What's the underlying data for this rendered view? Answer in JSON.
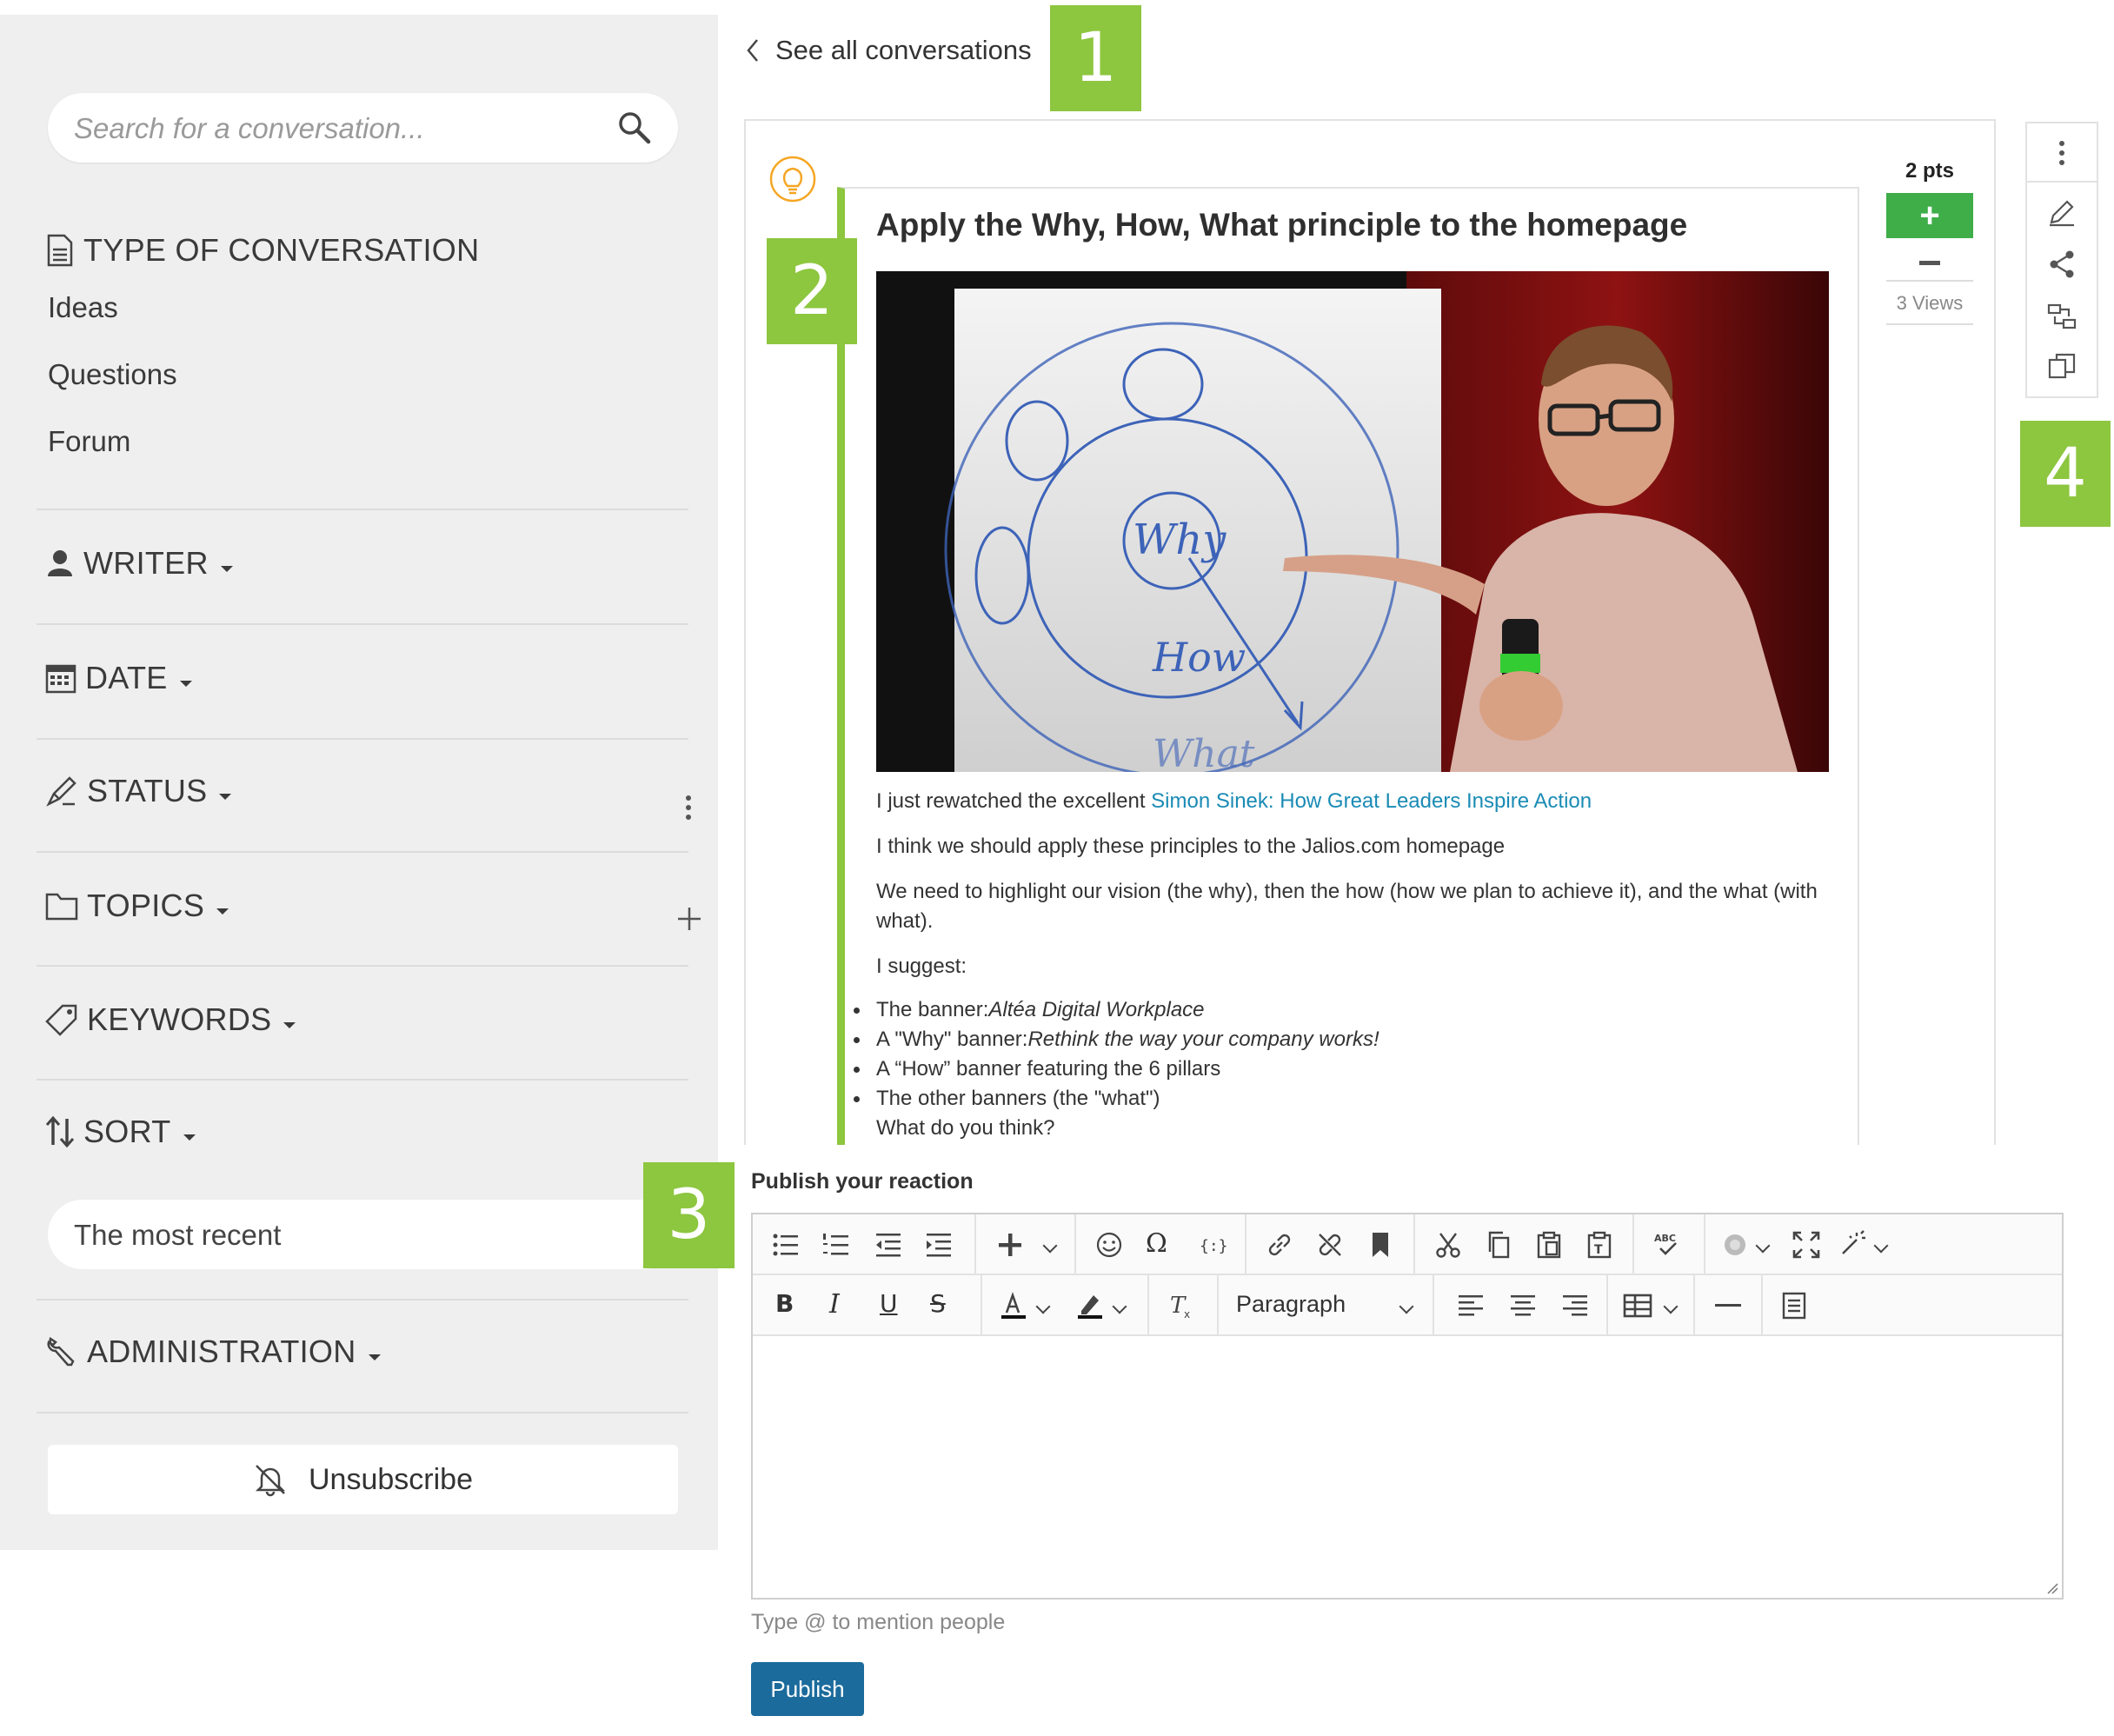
{
  "sidebar": {
    "search_placeholder": "Search for a conversation...",
    "type_section": {
      "title": "TYPE OF CONVERSATION",
      "items": [
        "Ideas",
        "Questions",
        "Forum"
      ]
    },
    "filters": {
      "writer": "WRITER",
      "date": "DATE",
      "status": "STATUS",
      "topics": "TOPICS",
      "keywords": "KEYWORDS",
      "sort": "SORT",
      "administration": "ADMINISTRATION"
    },
    "sort_value": "The most recent",
    "unsubscribe_label": "Unsubscribe"
  },
  "callouts": [
    "1",
    "2",
    "3",
    "4"
  ],
  "header": {
    "back_link": "See all conversations"
  },
  "post": {
    "title": "Apply the Why, How, What principle to the homepage",
    "intro_prefix": "I just rewatched the excellent ",
    "intro_link": "Simon Sinek: How Great Leaders Inspire Action",
    "para2": "I think we should apply these principles to the Jalios.com homepage",
    "para3": "We need to highlight our vision (the why), then the how (how we plan to achieve it), and the what (with what).",
    "para4": "I suggest:",
    "list": [
      {
        "prefix": "The banner:",
        "emph": "Altéa Digital Workplace"
      },
      {
        "prefix": "A \"Why\" banner:",
        "emph": "Rethink the way your company works!"
      },
      {
        "prefix": "A “How” banner featuring the 6 pillars",
        "emph": ""
      },
      {
        "prefix": "The other banners (the \"what\")",
        "emph": ""
      }
    ],
    "closing": "What do you think?",
    "image_handwriting": {
      "why": "Why",
      "how": "How",
      "what": "What"
    }
  },
  "vote": {
    "points": "2 pts",
    "up_label": "+",
    "views": "3 Views"
  },
  "editor": {
    "label": "Publish your reaction",
    "paragraph_select": "Paragraph",
    "mention_hint": "Type @ to mention people",
    "publish_label": "Publish",
    "spellcheck_text": "ABC"
  },
  "colors": {
    "accent_green": "#8dc63f",
    "vote_green": "#3fae49",
    "link_blue": "#1a8bb5",
    "publish_blue": "#1b6b9c",
    "sidebar_bg": "#efefef"
  }
}
